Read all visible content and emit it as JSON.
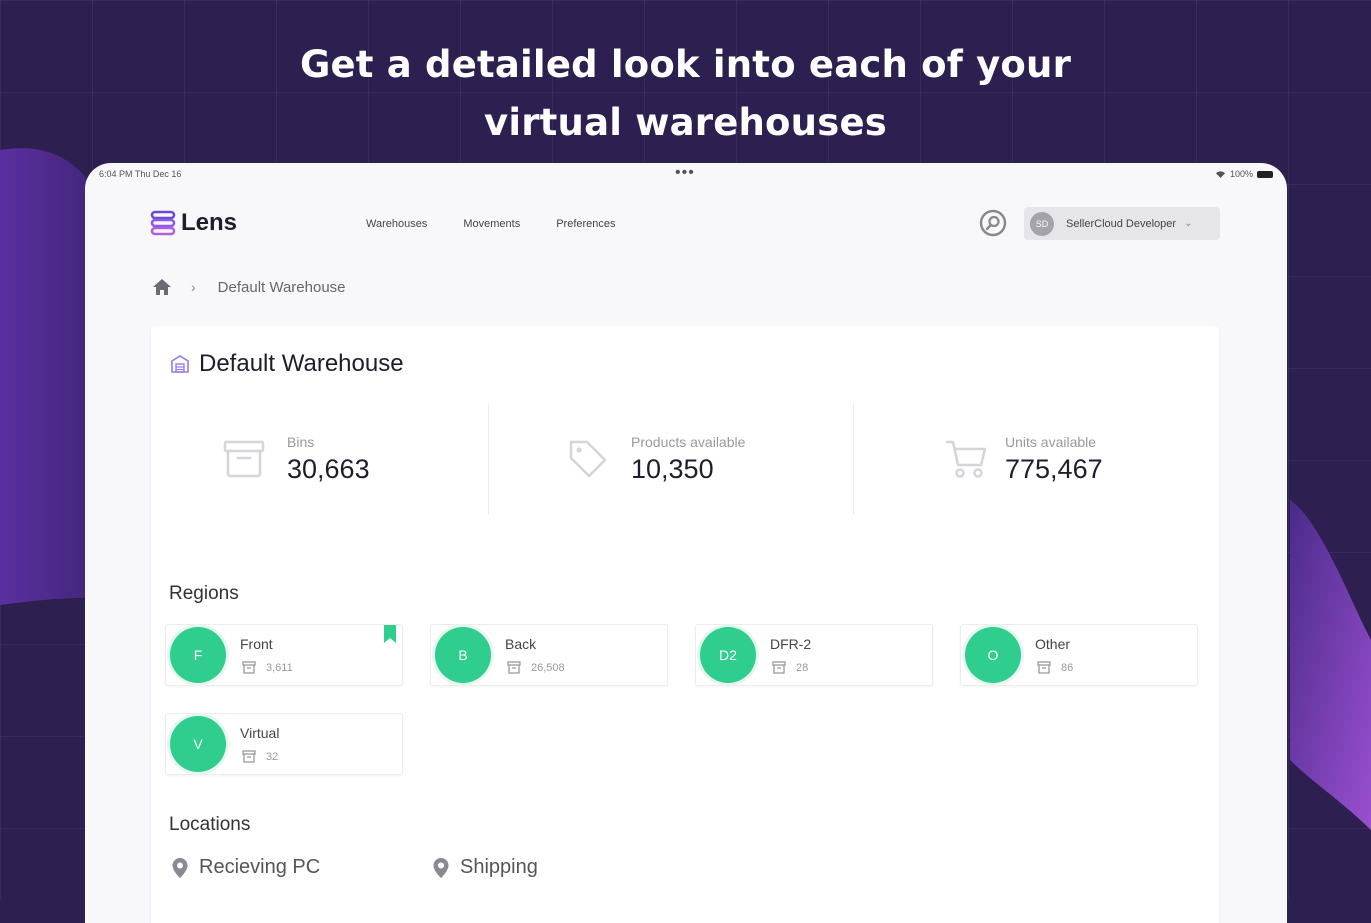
{
  "headline": {
    "line1": "Get a detailed look into each of your",
    "line2": "virtual warehouses"
  },
  "status_bar": {
    "time": "6:04 PM   Thu Dec 16",
    "dots": "•••",
    "battery": "100%"
  },
  "app": {
    "logo": "Lens",
    "nav": [
      "Warehouses",
      "Movements",
      "Preferences"
    ],
    "user": {
      "initials": "SD",
      "name": "SellerCloud Developer"
    }
  },
  "breadcrumb": {
    "current": "Default Warehouse"
  },
  "warehouse": {
    "title": "Default Warehouse",
    "stats": [
      {
        "label": "Bins",
        "value": "30,663",
        "icon": "archive-box-icon"
      },
      {
        "label": "Products available",
        "value": "10,350",
        "icon": "tag-icon"
      },
      {
        "label": "Units available",
        "value": "775,467",
        "icon": "shopping-cart-icon"
      }
    ]
  },
  "regions": {
    "title": "Regions",
    "items": [
      {
        "initial": "F",
        "name": "Front",
        "count": "3,611",
        "bookmarked": true
      },
      {
        "initial": "B",
        "name": "Back",
        "count": "26,508",
        "bookmarked": false
      },
      {
        "initial": "D2",
        "name": "DFR-2",
        "count": "28",
        "bookmarked": false
      },
      {
        "initial": "O",
        "name": "Other",
        "count": "86",
        "bookmarked": false
      },
      {
        "initial": "V",
        "name": "Virtual",
        "count": "32",
        "bookmarked": false
      }
    ]
  },
  "locations": {
    "title": "Locations",
    "items": [
      "Recieving PC",
      "Shipping"
    ]
  },
  "colors": {
    "background": "#2d2050",
    "accent": "#6a4bd8",
    "region_avatar": "#2fcd8e"
  }
}
